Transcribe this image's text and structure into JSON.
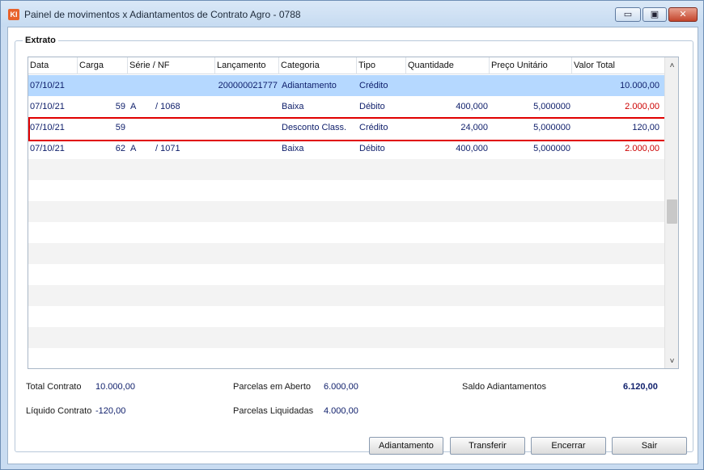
{
  "window": {
    "app_icon_text": "KI",
    "title": "Painel de movimentos x Adiantamentos de Contrato Agro - 0788",
    "min_glyph": "▭",
    "max_glyph": "▣",
    "close_glyph": "✕"
  },
  "group": {
    "label": "Extrato"
  },
  "grid": {
    "columns": [
      "Data",
      "Carga",
      "Série / NF",
      "Lançamento",
      "Categoria",
      "Tipo",
      "Quantidade",
      "Preço Unitário",
      "Valor Total"
    ],
    "rows": [
      {
        "data": "07/10/21",
        "carga": "",
        "serie": "",
        "nf": "",
        "lancamento": "200000021777",
        "categoria": "Adiantamento",
        "tipo": "Crédito",
        "quantidade": "",
        "preco": "",
        "valor": "10.000,00"
      },
      {
        "data": "07/10/21",
        "carga": "59",
        "serie": "A",
        "nf": "/ 1068",
        "lancamento": "",
        "categoria": "Baixa",
        "tipo": "Débito",
        "quantidade": "400,000",
        "preco": "5,000000",
        "valor": "2.000,00"
      },
      {
        "data": "07/10/21",
        "carga": "59",
        "serie": "",
        "nf": "",
        "lancamento": "",
        "categoria": "Desconto Class.",
        "tipo": "Crédito",
        "quantidade": "24,000",
        "preco": "5,000000",
        "valor": "120,00"
      },
      {
        "data": "07/10/21",
        "carga": "62",
        "serie": "A",
        "nf": "/ 1071",
        "lancamento": "",
        "categoria": "Baixa",
        "tipo": "Débito",
        "quantidade": "400,000",
        "preco": "5,000000",
        "valor": "2.000,00"
      }
    ],
    "scroll_up": "˄",
    "scroll_down": "˅"
  },
  "summary": {
    "total_contrato_label": "Total Contrato",
    "total_contrato": "10.000,00",
    "liquido_contrato_label": "Líquido Contrato",
    "liquido_contrato": "-120,00",
    "parcelas_aberto_label": "Parcelas em Aberto",
    "parcelas_aberto": "6.000,00",
    "parcelas_liquidadas_label": "Parcelas Liquidadas",
    "parcelas_liquidadas": "4.000,00",
    "saldo_label": "Saldo Adiantamentos",
    "saldo": "6.120,00"
  },
  "buttons": {
    "adiantamento": "Adiantamento",
    "transferir": "Transferir",
    "encerrar": "Encerrar",
    "sair": "Sair"
  },
  "colors": {
    "selected_row": "#b5d8ff",
    "debit_value": "#cc0000",
    "text": "#10206c",
    "highlight_border": "#e00000"
  }
}
